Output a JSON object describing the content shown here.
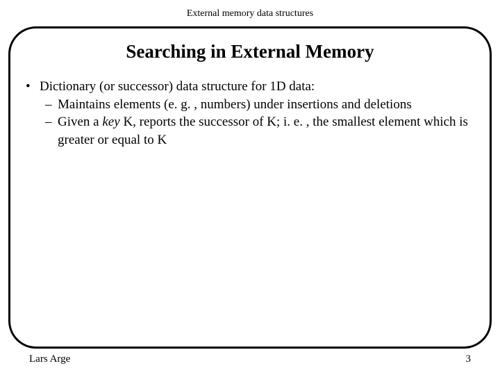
{
  "header": "External memory data structures",
  "title": "Searching in External Memory",
  "bullet": {
    "main": "Dictionary (or successor) data structure for  1D data:",
    "sub1": "Maintains elements (e. g. , numbers) under insertions and deletions",
    "sub2a": "Given a ",
    "sub2_key": "key",
    "sub2b": " K, reports the successor of K;  i. e. , the smallest element which is greater or equal to K"
  },
  "footer": {
    "author": "Lars Arge",
    "page": "3"
  }
}
